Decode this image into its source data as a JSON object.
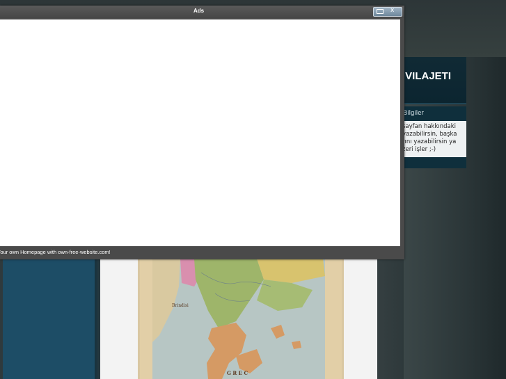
{
  "popup": {
    "title": "Ads",
    "footer_link": "Your own Homepage with own-free-website.com!",
    "maximize_icon": "maximize-icon",
    "close_glyph": "x"
  },
  "site": {
    "header_title": "KI VILAJETI",
    "info_title": "lı Bilgiler",
    "info_lines": [
      "sayfan hakkındaki",
      "yazabilirsin, başka",
      "rını yazabilirsin ya",
      "zeri işler ;-)"
    ]
  },
  "map": {
    "labels": [
      "Brindisi",
      "G R E C"
    ]
  },
  "colors": {
    "popup_frame": "#4a4a4a",
    "header_bg": "#102a35",
    "left_panel": "#1d4d66",
    "map_paper": "#e2cfa7"
  }
}
